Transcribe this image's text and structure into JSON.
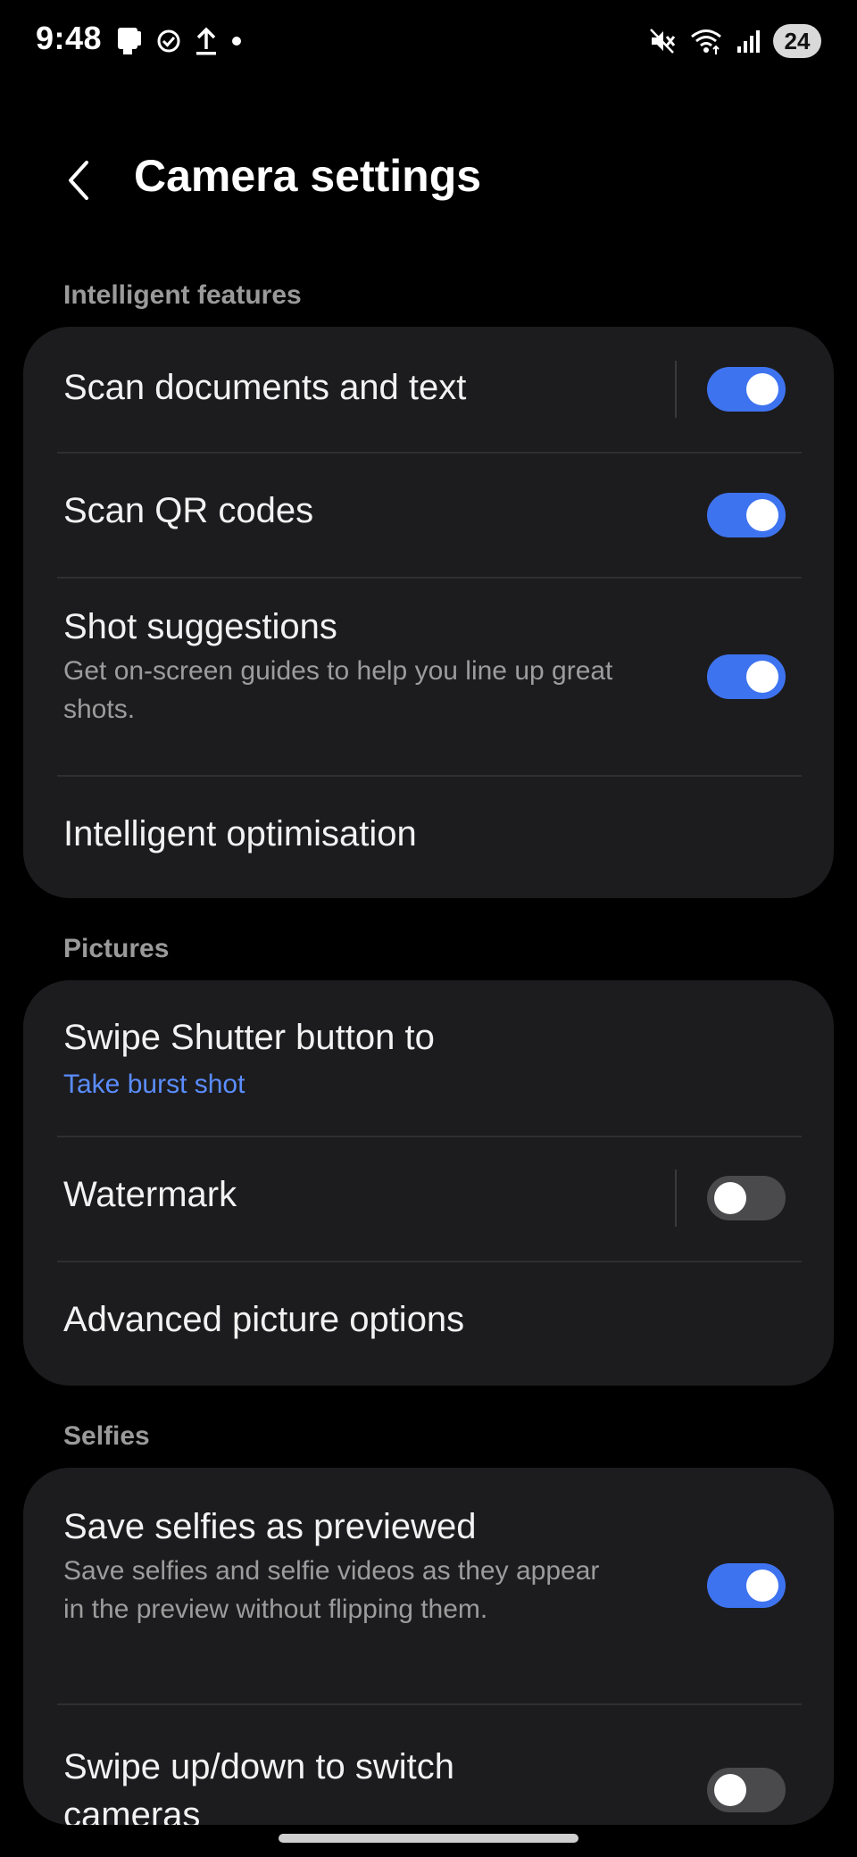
{
  "status_bar": {
    "time": "9:48",
    "battery": "24",
    "left_icons": [
      "sim-card-icon",
      "check-circle-icon",
      "upload-icon",
      "dot-icon"
    ],
    "right_icons": [
      "mute-icon",
      "wifi-icon",
      "signal-icon"
    ]
  },
  "header": {
    "title": "Camera settings",
    "back_icon": "chevron-left-icon"
  },
  "sections": {
    "intelligent": {
      "label": "Intelligent features",
      "items": [
        {
          "title": "Scan documents and text",
          "toggle": true
        },
        {
          "title": "Scan QR codes",
          "toggle": true
        },
        {
          "title": "Shot suggestions",
          "subtitle": "Get on-screen guides to help you line up great shots.",
          "toggle": true
        },
        {
          "title": "Intelligent optimisation"
        }
      ]
    },
    "pictures": {
      "label": "Pictures",
      "items": [
        {
          "title": "Swipe Shutter button to",
          "value": "Take burst shot"
        },
        {
          "title": "Watermark",
          "toggle": false
        },
        {
          "title": "Advanced picture options"
        }
      ]
    },
    "selfies": {
      "label": "Selfies",
      "items": [
        {
          "title": "Save selfies as previewed",
          "subtitle": "Save selfies and selfie videos as they appear in the preview without flipping them.",
          "toggle": true
        },
        {
          "title": "Swipe up/down to switch cameras",
          "toggle": false
        }
      ]
    }
  },
  "colors": {
    "accent": "#3e73f0",
    "link": "#5b8dff",
    "card": "#1c1c1e",
    "background": "#000000"
  }
}
